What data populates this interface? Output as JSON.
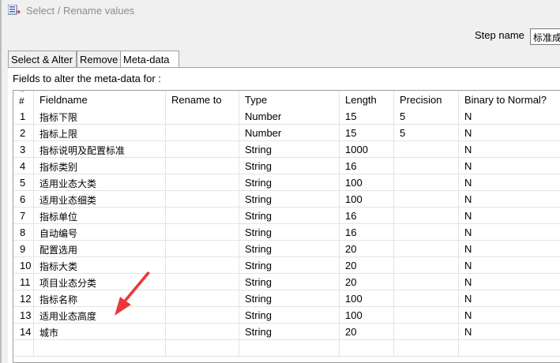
{
  "window": {
    "title": "Select / Rename values"
  },
  "step": {
    "label": "Step name",
    "value": "标准成"
  },
  "tabs": [
    {
      "label": "Select & Alter",
      "active": false
    },
    {
      "label": "Remove",
      "active": false
    },
    {
      "label": "Meta-data",
      "active": true
    }
  ],
  "meta": {
    "fields_label": "Fields to alter the meta-data for :"
  },
  "table": {
    "columns": [
      "#",
      "Fieldname",
      "Rename to",
      "Type",
      "Length",
      "Precision",
      "Binary to Normal?"
    ],
    "rows": [
      [
        "1",
        "指标下限",
        "",
        "Number",
        "15",
        "5",
        "N"
      ],
      [
        "2",
        "指标上限",
        "",
        "Number",
        "15",
        "5",
        "N"
      ],
      [
        "3",
        "指标说明及配置标准",
        "",
        "String",
        "1000",
        "",
        "N"
      ],
      [
        "4",
        "指标类别",
        "",
        "String",
        "16",
        "",
        "N"
      ],
      [
        "5",
        "适用业态大类",
        "",
        "String",
        "100",
        "",
        "N"
      ],
      [
        "6",
        "适用业态细类",
        "",
        "String",
        "100",
        "",
        "N"
      ],
      [
        "7",
        "指标单位",
        "",
        "String",
        "16",
        "",
        "N"
      ],
      [
        "8",
        "自动编号",
        "",
        "String",
        "16",
        "",
        "N"
      ],
      [
        "9",
        "配置选用",
        "",
        "String",
        "20",
        "",
        "N"
      ],
      [
        "10",
        "指标大类",
        "",
        "String",
        "20",
        "",
        "N"
      ],
      [
        "11",
        "项目业态分类",
        "",
        "String",
        "20",
        "",
        "N"
      ],
      [
        "12",
        "指标名称",
        "",
        "String",
        "100",
        "",
        "N"
      ],
      [
        "13",
        "适用业态高度",
        "",
        "String",
        "100",
        "",
        "N"
      ],
      [
        "14",
        "城市",
        "",
        "String",
        "20",
        "",
        "N"
      ]
    ]
  },
  "annotation": {
    "color": "#e83a3a",
    "icon": "red-pointer-arrow-icon"
  }
}
